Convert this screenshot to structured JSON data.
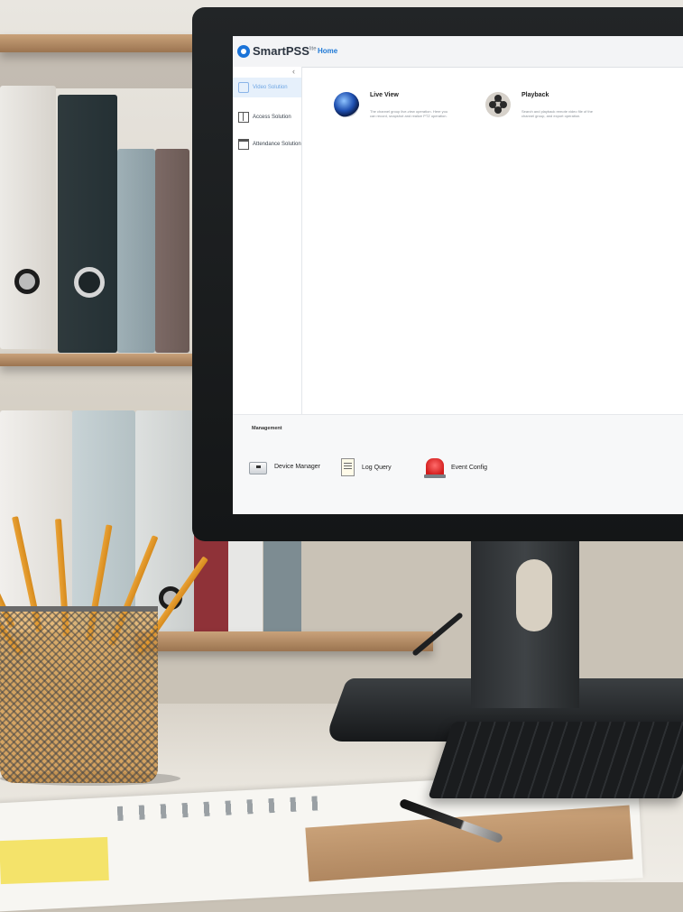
{
  "app": {
    "name": "SmartPSS",
    "name_sup": "lite",
    "top_tab": "Home",
    "collapse_glyph": "‹",
    "accent": "#1f79d6"
  },
  "sidebar": {
    "items": [
      {
        "label": "Video Solution",
        "icon": "video-solution-icon",
        "active": true
      },
      {
        "label": "Access Solution",
        "icon": "door-icon",
        "active": false
      },
      {
        "label": "Attendance Solution",
        "icon": "calendar-check-icon",
        "active": false
      }
    ]
  },
  "features": [
    {
      "title": "Live View",
      "description": "The channel group live-view operation. Here you can record, snapshot and realize PTZ operation.",
      "icon": "live-view-camera-icon"
    },
    {
      "title": "Playback",
      "description": "Search and playback remote video file of the channel group, and export operation.",
      "icon": "film-reel-icon"
    }
  ],
  "management": {
    "title": "Management",
    "items": [
      {
        "label": "Device Manager",
        "icon": "device-manager-icon"
      },
      {
        "label": "Log Query",
        "icon": "log-document-icon"
      },
      {
        "label": "Event Config",
        "icon": "alarm-light-icon"
      }
    ]
  }
}
